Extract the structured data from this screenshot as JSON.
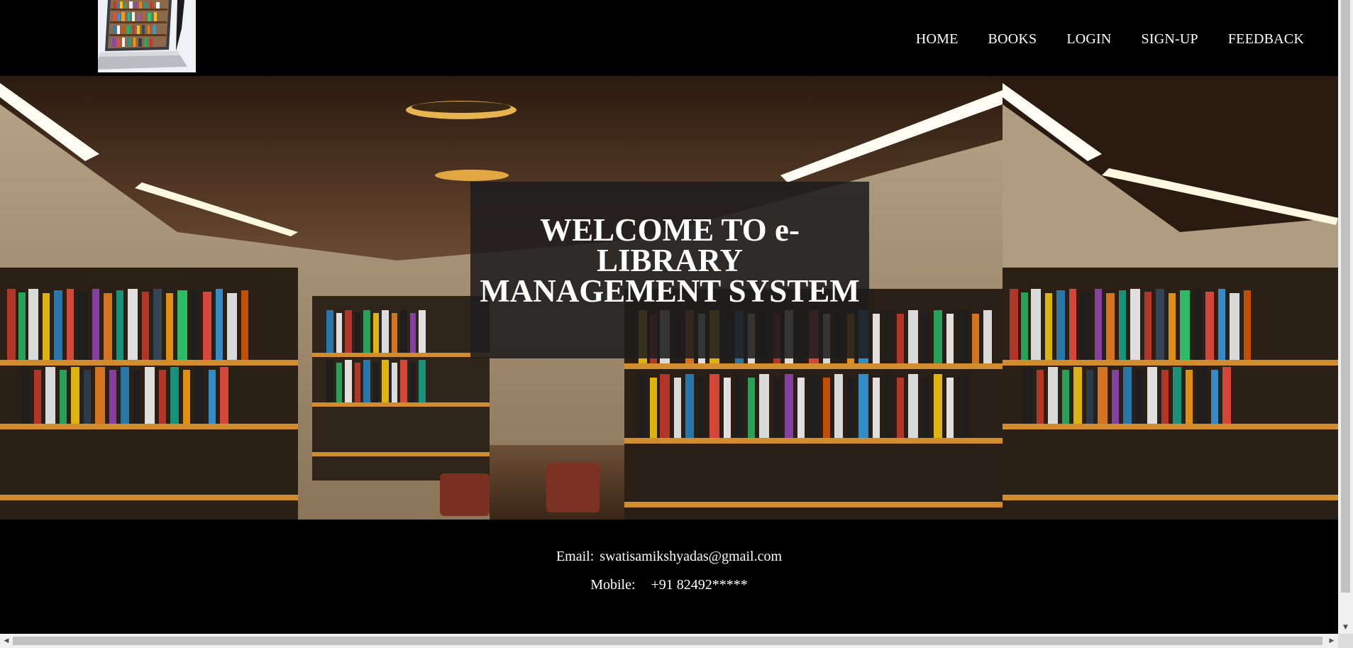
{
  "header": {
    "logo_alt": "e-Library logo",
    "nav": [
      {
        "label": "HOME"
      },
      {
        "label": "BOOKS"
      },
      {
        "label": "LOGIN"
      },
      {
        "label": "SIGN-UP"
      },
      {
        "label": "FEEDBACK"
      }
    ]
  },
  "hero": {
    "line1": "WELCOME TO e-LIBRARY",
    "line2": "MANAGEMENT SYSTEM"
  },
  "footer": {
    "email_label": "Email:",
    "email_value": "swatisamikshyadas@gmail.com",
    "mobile_label": "Mobile:",
    "mobile_value": "+91 82492*****"
  },
  "colors": {
    "background": "#000000",
    "text": "#ffffff",
    "overlay": "#1e1c1e",
    "shelf_wood": "#c8892f"
  }
}
